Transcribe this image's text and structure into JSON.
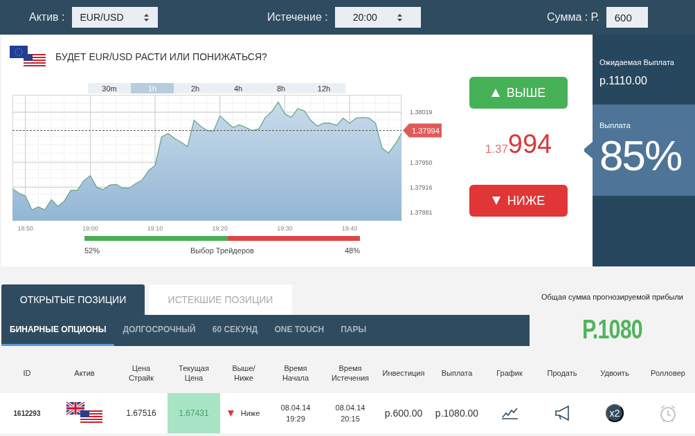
{
  "top_bar": {
    "fields": [
      {
        "kind": "select",
        "label": "Актив :",
        "value": "EUR/USD"
      },
      {
        "kind": "select",
        "label": "Истечение :",
        "value": "20:00"
      },
      {
        "kind": "input",
        "label": "Сумма : Р.",
        "value": "600"
      }
    ]
  },
  "trade_panel": {
    "question": "БУДЕТ EUR/USD РАСТИ ИЛИ ПОНИЖАТЬСЯ?",
    "range_tabs": [
      {
        "label": "30m",
        "selected": false
      },
      {
        "label": "1h",
        "selected": true
      },
      {
        "label": "2h",
        "selected": false
      },
      {
        "label": "4h",
        "selected": false
      },
      {
        "label": "8h",
        "selected": false
      },
      {
        "label": "12h",
        "selected": false
      }
    ],
    "chart_data": {
      "type": "area",
      "ylim": [
        1.3787,
        1.38043
      ],
      "yticks": [
        {
          "value": 1.38019,
          "label": "1.38019"
        },
        {
          "value": 1.3795,
          "label": "1.37950"
        },
        {
          "value": 1.37916,
          "label": "1.37916"
        },
        {
          "value": 1.37881,
          "label": "1.37881"
        }
      ],
      "categories": [
        null,
        null,
        "18:50",
        null,
        null,
        null,
        null,
        null,
        null,
        null,
        null,
        null,
        "19:00",
        null,
        null,
        null,
        null,
        null,
        null,
        null,
        null,
        null,
        "19:10",
        null,
        null,
        null,
        null,
        null,
        null,
        null,
        null,
        null,
        "19:20",
        null,
        null,
        null,
        null,
        null,
        null,
        null,
        null,
        null,
        "19:30",
        null,
        null,
        null,
        null,
        null,
        null,
        null,
        null,
        null,
        "19:40",
        null,
        null,
        null,
        null,
        null,
        null,
        null,
        null
      ],
      "values": [
        1.37914,
        1.37908,
        1.37904,
        1.37885,
        1.37889,
        1.37885,
        1.37899,
        1.3789,
        1.37897,
        1.37912,
        1.37912,
        1.37925,
        1.37932,
        1.37916,
        1.37913,
        1.37919,
        1.3792,
        1.37915,
        1.37915,
        1.37921,
        1.37926,
        1.37939,
        1.37946,
        1.37985,
        1.3799,
        1.37983,
        1.37978,
        1.37972,
        1.38008,
        1.38,
        1.37994,
        1.37993,
        1.38014,
        1.38006,
        1.37998,
        1.38002,
        1.37998,
        1.37994,
        1.37996,
        1.38012,
        1.3802,
        1.38033,
        1.38017,
        1.38012,
        1.38024,
        1.38021,
        1.38008,
        1.38,
        1.38004,
        1.38004,
        1.38001,
        1.38011,
        1.38004,
        1.38011,
        1.38012,
        1.38011,
        1.38004,
        1.3797,
        1.37963,
        1.37975,
        1.3799
      ],
      "grid": true,
      "ref_lines": [
        {
          "axis": "y",
          "value": 1.37994,
          "label": "1.37994"
        }
      ]
    },
    "traders_choice": {
      "level": 0.52,
      "up_share": "52%",
      "label": "Выбор Трейдеров",
      "down_share": "48%"
    },
    "up_button": "ВЫШЕ",
    "price_prefix": "1.37",
    "price_main": "994",
    "down_button": "НИЖЕ"
  },
  "payout_panel": {
    "expected_label": "Ожидаемая Выплата",
    "expected_value": "р.1110.00",
    "payout_label": "Выплата",
    "payout_percent": "85%"
  },
  "positions": {
    "tabs": [
      {
        "label": "ОТКРЫТЫЕ ПОЗИЦИИ",
        "selected": true
      },
      {
        "label": "ИСТЕКШИЕ ПОЗИЦИИ",
        "selected": false
      }
    ],
    "subtabs": [
      {
        "label": "БИНАРНЫЕ ОПЦИОНЫ",
        "selected": true
      },
      {
        "label": "ДОЛГОСРОЧНЫЙ",
        "selected": false
      },
      {
        "label": "60 СЕКУНД",
        "selected": false
      },
      {
        "label": "ONE TOUCH",
        "selected": false
      },
      {
        "label": "ПАРЫ",
        "selected": false
      }
    ],
    "total_label": "Общая сумма прогнозируемой прибыли",
    "total_value": "Р.1080"
  },
  "table": {
    "columns": [
      "ID",
      "Актив",
      "Цена Страйк",
      "Текущая Цена",
      "Выше/Ниже",
      "Время Начала",
      "Время Истечения",
      "Инвестиция",
      "Выплата",
      "График",
      "Продать",
      "Удвоить",
      "Ролловер"
    ],
    "rows": [
      [
        {
          "kind": "id",
          "text": "1612293"
        },
        {
          "kind": "flag"
        },
        {
          "kind": "text",
          "text": "1.67516"
        },
        {
          "kind": "current",
          "text": "1.67431"
        },
        {
          "kind": "direction",
          "up": false,
          "text": "Ниже"
        },
        {
          "kind": "text",
          "text": "08.04.14 19:29"
        },
        {
          "kind": "text",
          "text": "08.04.14 20:15"
        },
        {
          "kind": "money",
          "text": "р.600.00"
        },
        {
          "kind": "money",
          "text": "р.1080.00"
        },
        {
          "kind": "chart"
        },
        {
          "kind": "sell"
        },
        {
          "kind": "double",
          "text": "x2"
        },
        {
          "kind": "rollover"
        }
      ]
    ]
  }
}
